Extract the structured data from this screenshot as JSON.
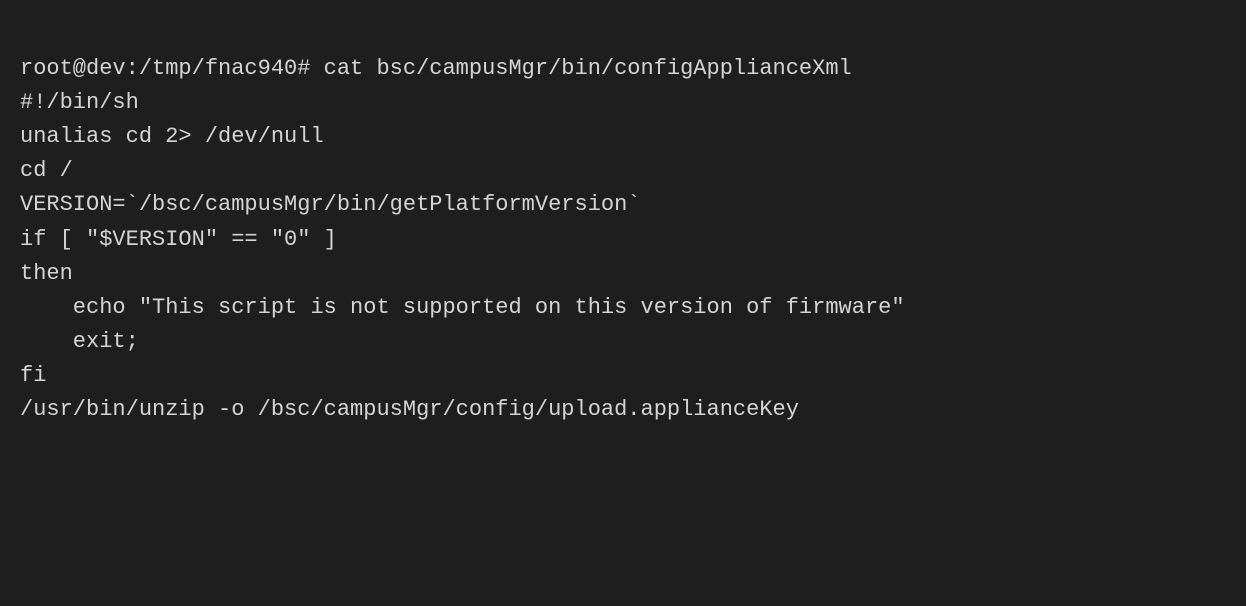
{
  "terminal": {
    "lines": [
      {
        "id": "l1",
        "text": "root@dev:/tmp/fnac940# cat bsc/campusMgr/bin/configApplianceXml"
      },
      {
        "id": "l2",
        "text": "#!/bin/sh"
      },
      {
        "id": "l3",
        "text": ""
      },
      {
        "id": "l4",
        "text": "unalias cd 2> /dev/null"
      },
      {
        "id": "l5",
        "text": ""
      },
      {
        "id": "l6",
        "text": "cd /"
      },
      {
        "id": "l7",
        "text": ""
      },
      {
        "id": "l8",
        "text": "VERSION=`/bsc/campusMgr/bin/getPlatformVersion`"
      },
      {
        "id": "l9",
        "text": "if [ \"$VERSION\" == \"0\" ]"
      },
      {
        "id": "l10",
        "text": "then"
      },
      {
        "id": "l11",
        "text": "    echo \"This script is not supported on this version of firmware\""
      },
      {
        "id": "l12",
        "text": "    exit;"
      },
      {
        "id": "l13",
        "text": "fi"
      },
      {
        "id": "l14",
        "text": ""
      },
      {
        "id": "l15",
        "text": "/usr/bin/unzip -o /bsc/campusMgr/config/upload.applianceKey"
      }
    ]
  }
}
